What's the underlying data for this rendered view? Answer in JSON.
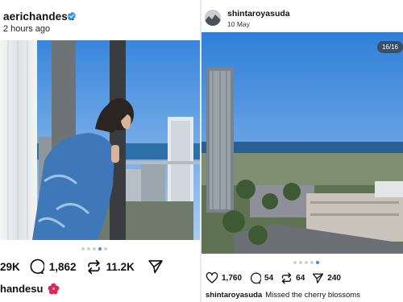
{
  "left_post": {
    "username": "aerichandesu",
    "time": "2 hours ago",
    "likes": "29K",
    "comments": "1,862",
    "reposts": "11.2K",
    "caption_user": "handesu",
    "carousel_total": 5,
    "carousel_active": 4
  },
  "right_post": {
    "username": "shintaroyasuda",
    "date": "10 May",
    "counter": "16/16",
    "likes": "1,760",
    "comments": "54",
    "reposts": "64",
    "shares": "240",
    "caption_user": "shintaroyasuda",
    "caption": "Missed the cherry blossoms",
    "carousel_total": 5,
    "carousel_active": 5
  },
  "colors": {
    "verified": "#3897f0",
    "dot_active": "#3e8de6",
    "dot_inactive": "#c9d0d6",
    "sky": "#3f8fe0",
    "ocean": "#2f6fa8"
  },
  "icons": [
    "verified-badge-icon",
    "heart-icon",
    "comment-icon",
    "repost-icon",
    "share-icon",
    "bookmark-icon",
    "mute-icon",
    "hibiscus-icon"
  ]
}
